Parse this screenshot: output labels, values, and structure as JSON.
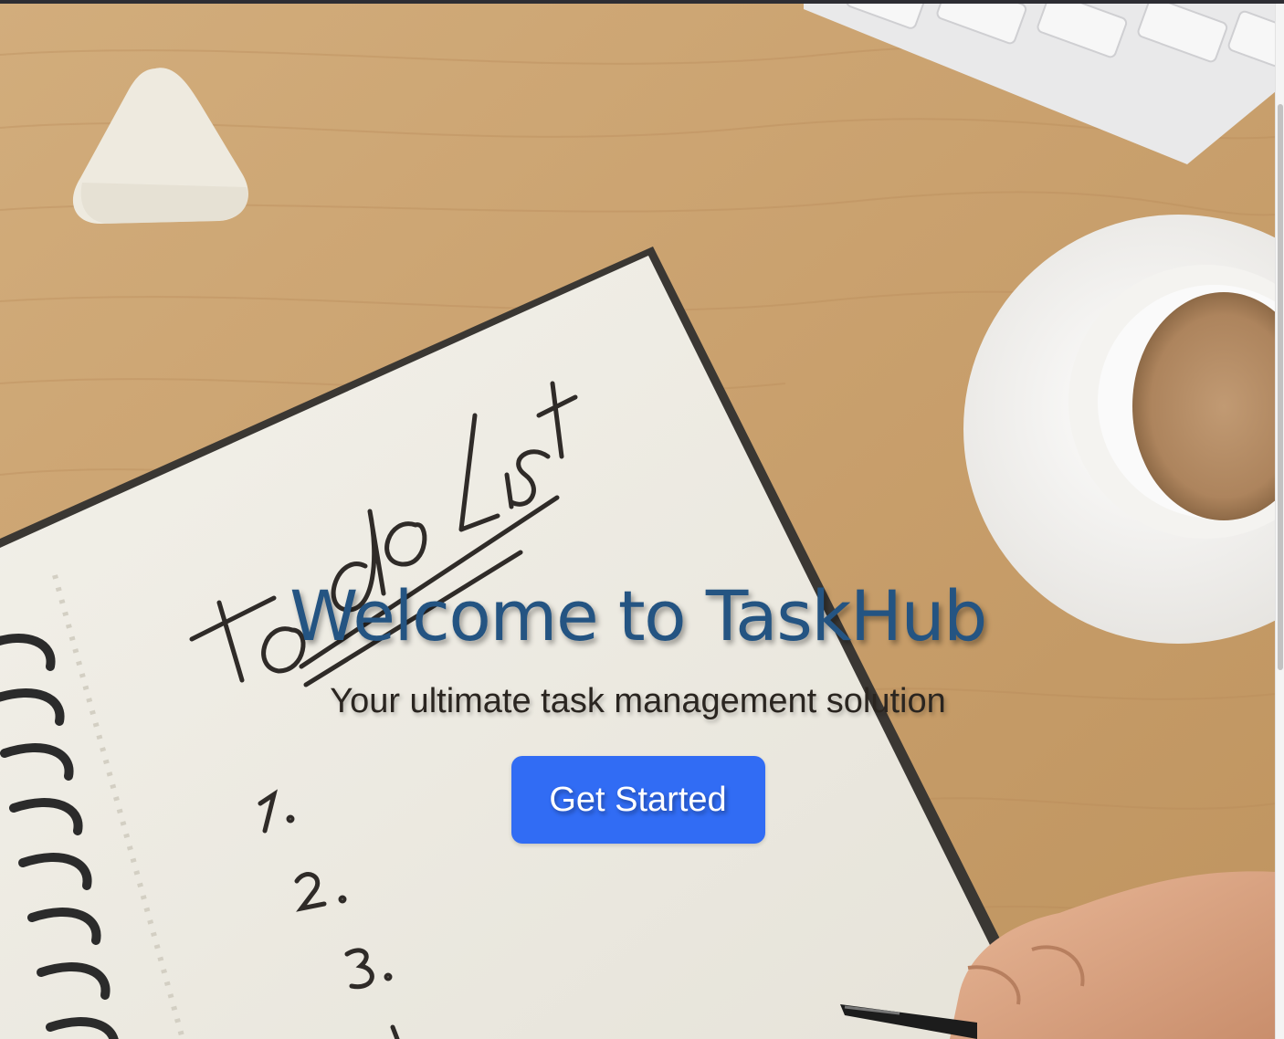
{
  "hero": {
    "title": "Welcome to TaskHub",
    "subtitle": "Your ultimate task management solution",
    "cta_label": "Get Started",
    "background_image": "Desk photo with notebook reading todo List, coffee cup, eraser and keyboard",
    "notebook_text": {
      "heading": "todo List",
      "items": [
        "1.",
        "2.",
        "3."
      ]
    }
  },
  "colors": {
    "title": "#245482",
    "subtitle": "#2a2520",
    "button_bg": "#316cf4",
    "button_text": "#ffffff",
    "desk": "#cfa978"
  }
}
